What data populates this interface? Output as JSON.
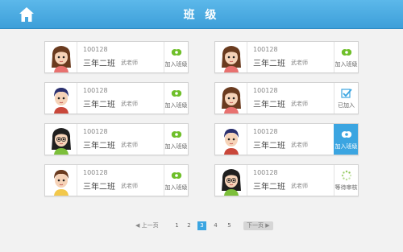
{
  "header": {
    "title": "班 级",
    "home_icon": "home-icon"
  },
  "classes": [
    {
      "code": "100128",
      "name": "三年二班",
      "teacher": "武老师",
      "action": "加入班级",
      "status": "join",
      "avatar": "girl-brown-hair"
    },
    {
      "code": "100128",
      "name": "三年二班",
      "teacher": "武老师",
      "action": "加入班级",
      "status": "join",
      "avatar": "girl-brown-hair"
    },
    {
      "code": "100128",
      "name": "三年二班",
      "teacher": "武老师",
      "action": "加入班级",
      "status": "join",
      "avatar": "boy-navy-hair"
    },
    {
      "code": "100128",
      "name": "三年二班",
      "teacher": "武老师",
      "action": "已加入",
      "status": "joined",
      "avatar": "girl-brown-hair"
    },
    {
      "code": "100128",
      "name": "三年二班",
      "teacher": "武老师",
      "action": "加入班级",
      "status": "join",
      "avatar": "girl-black-hair-glasses"
    },
    {
      "code": "100128",
      "name": "三年二班",
      "teacher": "武老师",
      "action": "加入班级",
      "status": "join-active",
      "avatar": "boy-navy-hair"
    },
    {
      "code": "100128",
      "name": "三年二班",
      "teacher": "武老师",
      "action": "加入班级",
      "status": "join",
      "avatar": "boy-brown-hair"
    },
    {
      "code": "100128",
      "name": "三年二班",
      "teacher": "武老师",
      "action": "等待审核",
      "status": "pending",
      "avatar": "girl-black-hair-glasses"
    }
  ],
  "pagination": {
    "prev_label": "上一页",
    "next_label": "下一页",
    "pages": [
      "1",
      "2",
      "3",
      "4",
      "5"
    ],
    "current": 3
  },
  "colors": {
    "accent": "#3ba5e1",
    "join_green": "#6fbf2a",
    "header_blue": "#4aaae2"
  }
}
